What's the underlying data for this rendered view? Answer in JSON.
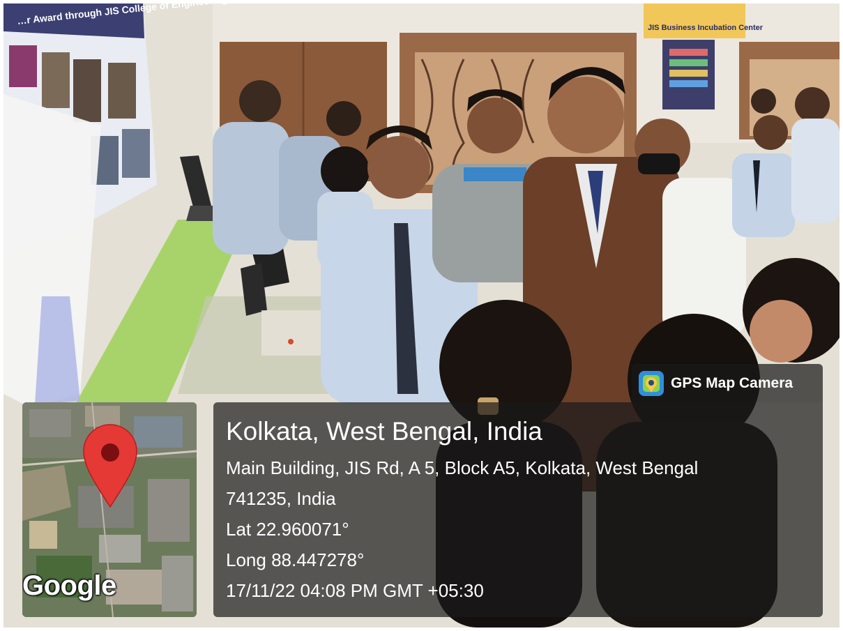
{
  "location": {
    "title": "Kolkata, West Bengal, India",
    "address_line1": "Main Building, JIS Rd, A 5, Block A5, Kolkata, West Bengal",
    "address_line2": "741235, India",
    "latitude": "Lat 22.960071°",
    "longitude": "Long 88.447278°",
    "timestamp": "17/11/22 04:08 PM GMT +05:30"
  },
  "app": {
    "name": "GPS Map Camera",
    "icon": "map-pin-camera-icon"
  },
  "map": {
    "brand": "Google",
    "marker_icon": "map-marker-icon",
    "marker_color": "#e53935"
  },
  "scene": {
    "poster_banner_text": "…r Award through JIS College of Engineering",
    "signboard_text": "JIS Business Incubation Center"
  },
  "colors": {
    "overlay": "#191919",
    "text": "#ffffff",
    "desk_green": "#a8d36b"
  }
}
